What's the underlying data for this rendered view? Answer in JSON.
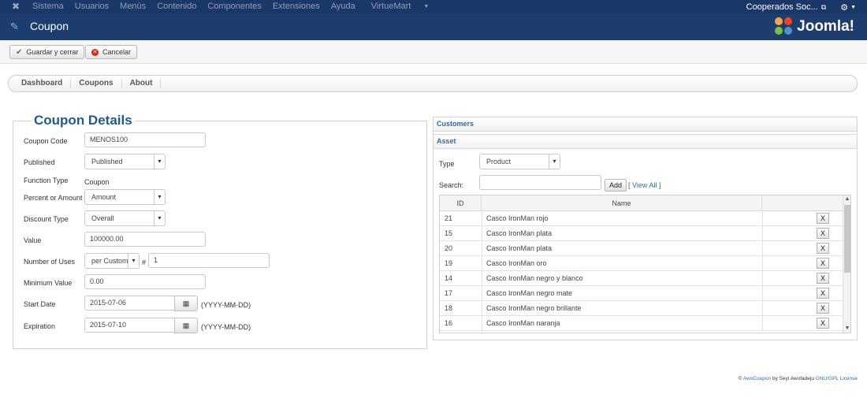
{
  "topbar": {
    "logo_icon": "joomla-icon",
    "menu": [
      "Sistema",
      "Usuarios",
      "Menús",
      "Contenido",
      "Componentes",
      "Extensiones",
      "Ayuda"
    ],
    "active_menu": "VirtueMart",
    "site_name": "Cooperados Soc...",
    "external_icon": "external-link-icon",
    "settings_icon": "gear-icon"
  },
  "titlebar": {
    "title": "Coupon",
    "icon": "edit-icon",
    "brand": "Joomla!"
  },
  "toolbar": {
    "save_close_label": "Guardar y cerrar",
    "cancel_label": "Cancelar"
  },
  "subnav": {
    "tabs": [
      "Dashboard",
      "Coupons",
      "About"
    ]
  },
  "details": {
    "legend": "Coupon Details",
    "coupon_code_label": "Coupon Code",
    "coupon_code_value": "MENOS100",
    "published_label": "Published",
    "published_value": "Published",
    "function_type_label": "Function Type",
    "function_type_value": "Coupon",
    "percent_amount_label": "Percent or Amount",
    "percent_amount_value": "Amount",
    "discount_type_label": "Discount Type",
    "discount_type_value": "Overall",
    "value_label": "Value",
    "value_value": "100000.00",
    "num_uses_label": "Number of Uses",
    "num_uses_select": "per Custom",
    "num_uses_hash": "#",
    "num_uses_value": "1",
    "min_value_label": "Minimum Value",
    "min_value_value": "0.00",
    "start_date_label": "Start Date",
    "start_date_value": "2015-07-06",
    "expiration_label": "Expiration",
    "expiration_value": "2015-07-10",
    "date_format_hint": "(YYYY-MM-DD)",
    "calendar_icon": "calendar-icon"
  },
  "customers": {
    "header": "Customers"
  },
  "asset": {
    "header": "Asset",
    "type_label": "Type",
    "type_value": "Product",
    "search_label": "Search:",
    "search_value": "",
    "add_label": "Add",
    "view_all_label": "[ View All ]",
    "columns": [
      "ID",
      "Name"
    ],
    "remove_label": "X",
    "rows": [
      {
        "id": "21",
        "name": "Casco IronMan rojo"
      },
      {
        "id": "15",
        "name": "Casco IronMan plata"
      },
      {
        "id": "20",
        "name": "Casco IronMan plata"
      },
      {
        "id": "19",
        "name": "Casco IronMan oro"
      },
      {
        "id": "14",
        "name": "Casco IronMan negro y blanco"
      },
      {
        "id": "17",
        "name": "Casco IronMan negro mate"
      },
      {
        "id": "18",
        "name": "Casco IronMan negro brillante"
      },
      {
        "id": "16",
        "name": "Casco IronMan naranja"
      }
    ]
  },
  "footer": {
    "copyright": "©",
    "product": "AwoCoupon",
    "by": "by Seyi Awofadeju",
    "license": "GNU/GPL License"
  }
}
